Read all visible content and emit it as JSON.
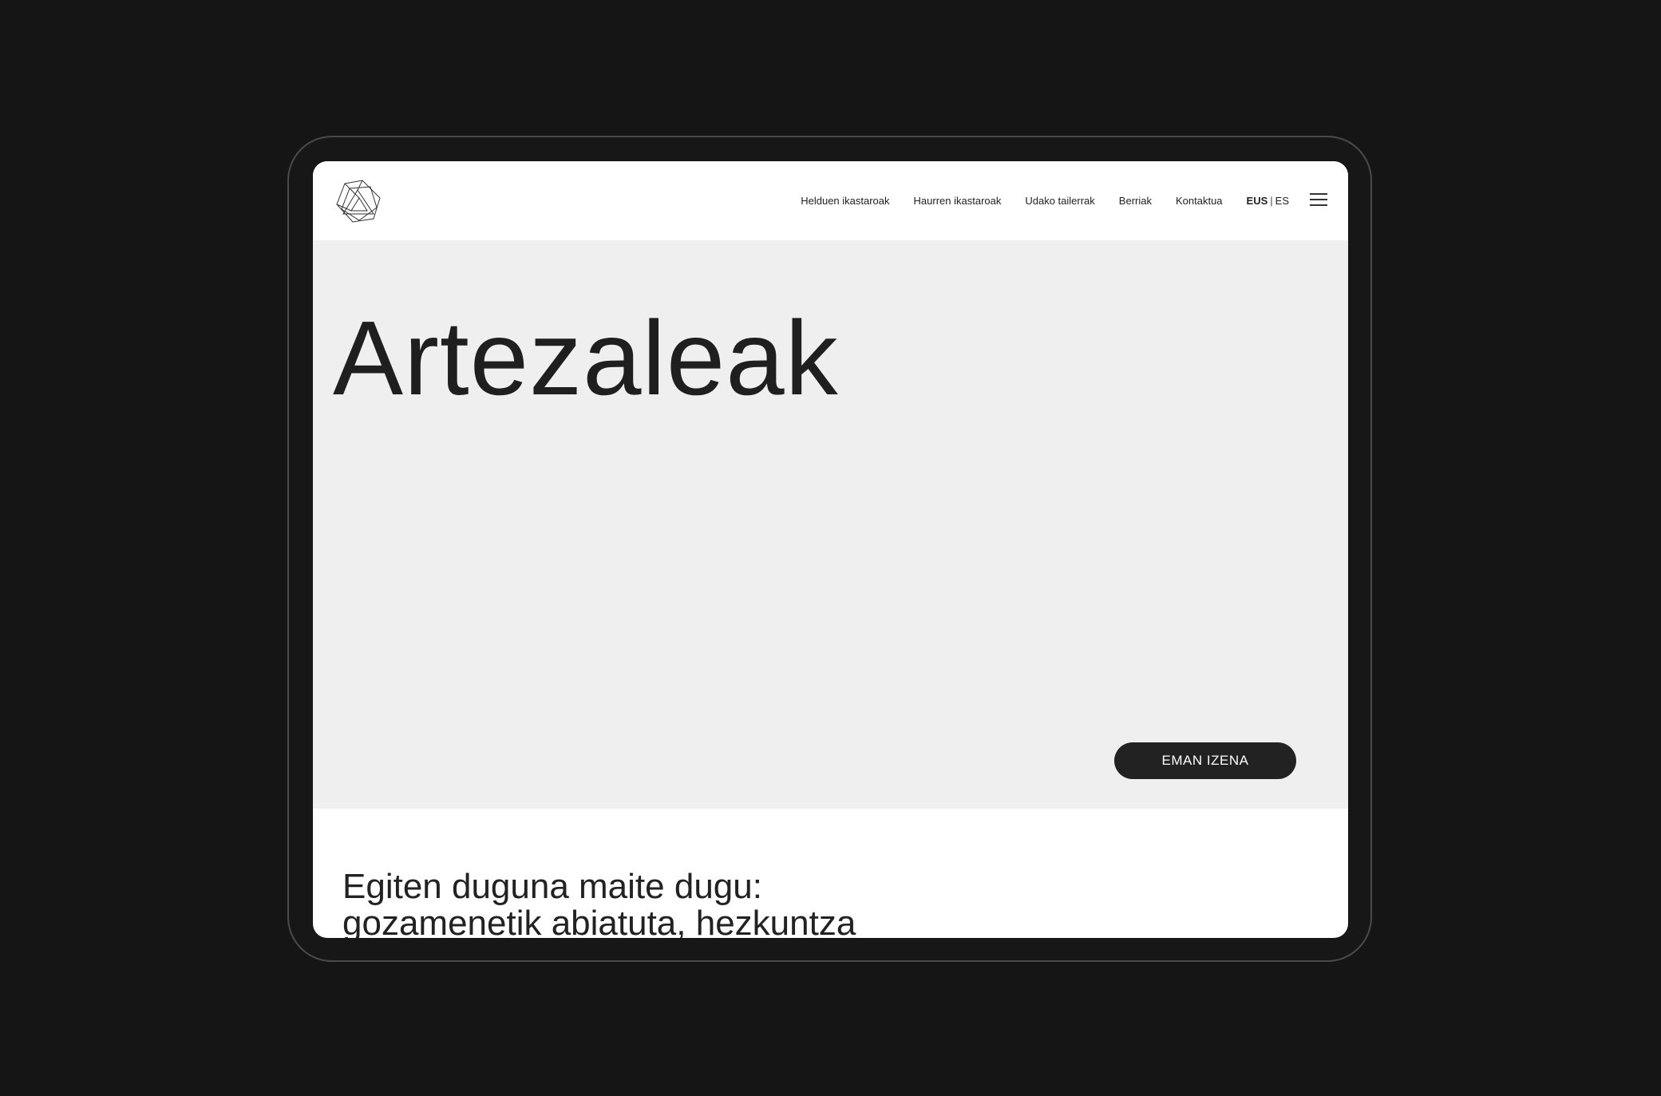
{
  "nav": {
    "items": [
      {
        "label": "Helduen ikastaroak"
      },
      {
        "label": "Haurren ikastaroak"
      },
      {
        "label": "Udako tailerrak"
      },
      {
        "label": "Berriak"
      },
      {
        "label": "Kontaktua"
      }
    ],
    "lang": {
      "active": "EUS",
      "separator": "|",
      "other": "ES"
    },
    "menu_icon": "hamburger-icon"
  },
  "logo_icon": "geometric-logo-icon",
  "hero": {
    "title": "Artezaleak",
    "cta_label": "EMAN IZENA",
    "background": "#efefef"
  },
  "intro": {
    "line1": "Egiten duguna maite dugu:",
    "line2": "gozamenetik abiatuta, hezkuntza"
  },
  "colors": {
    "page_bg": "#151515",
    "button_bg": "#222222",
    "text": "#1f1f1f"
  }
}
